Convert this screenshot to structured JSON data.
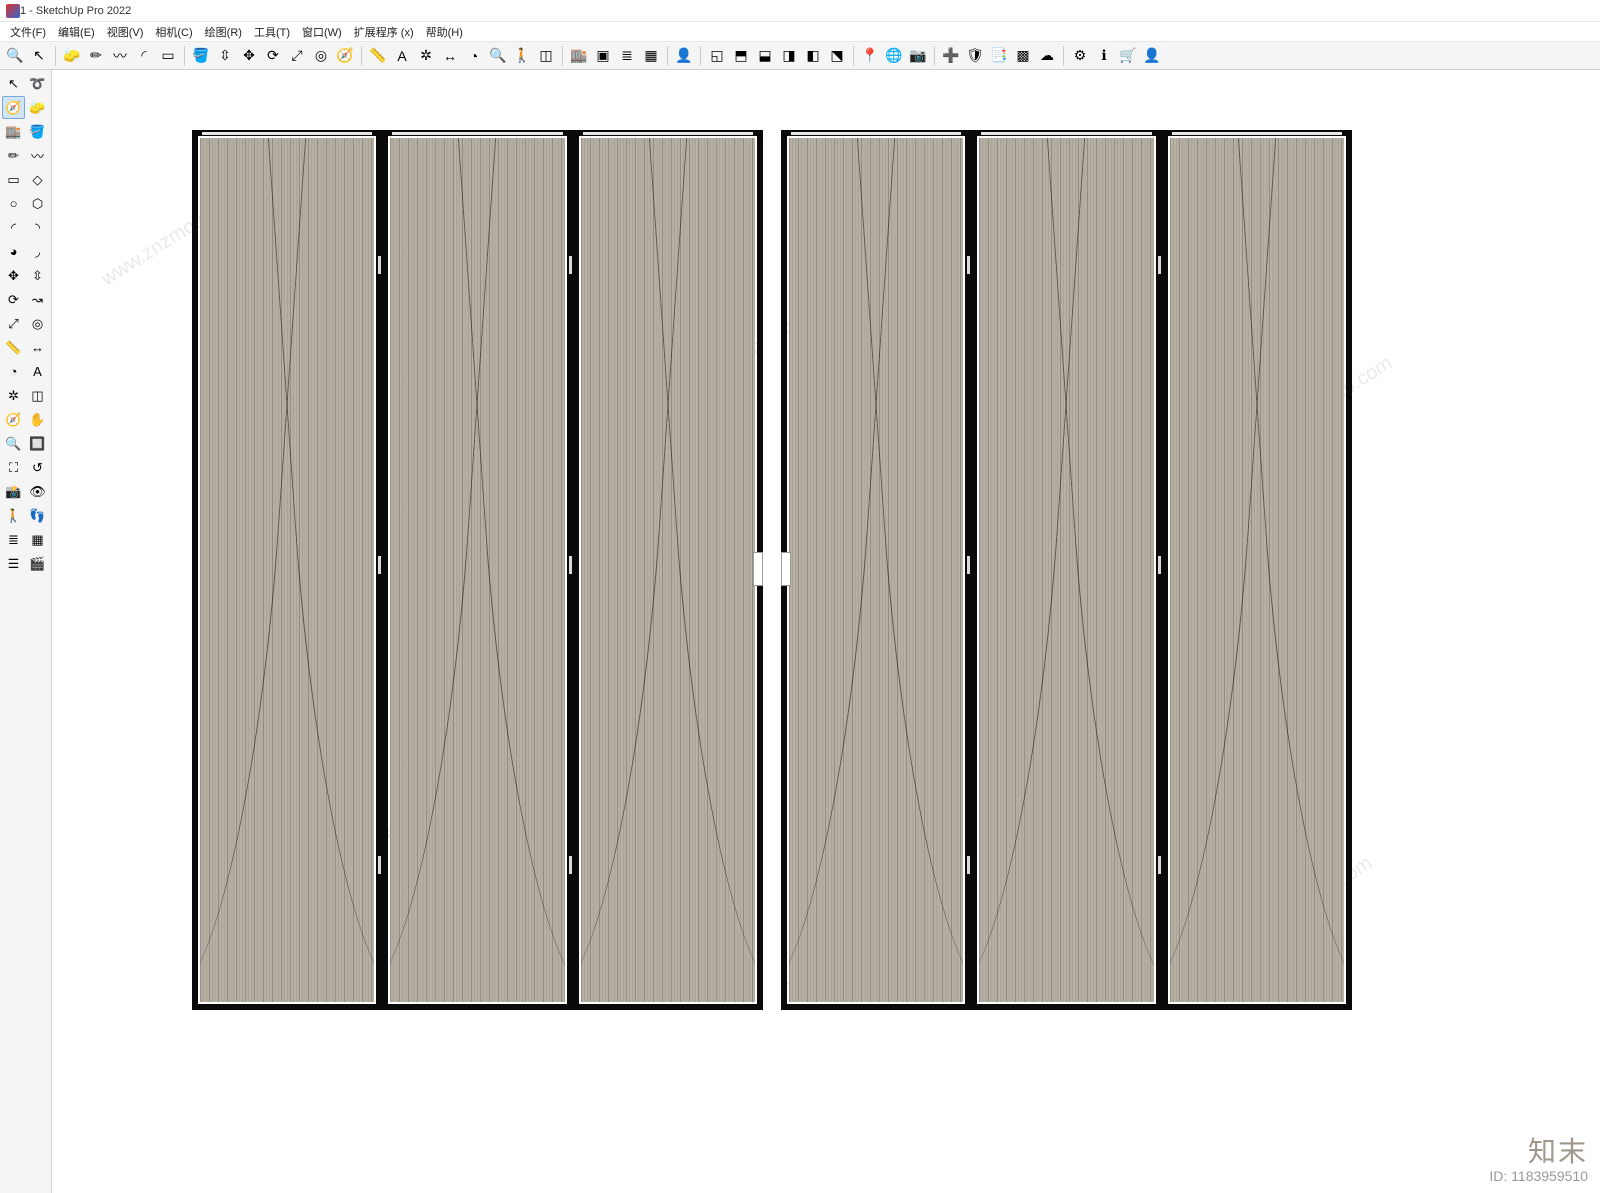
{
  "title": "1 - SketchUp Pro 2022",
  "menu": {
    "file": "文件(F)",
    "edit": "编辑(E)",
    "view": "视图(V)",
    "camera": "相机(C)",
    "draw": "绘图(R)",
    "tools": "工具(T)",
    "window": "窗口(W)",
    "extensions": "扩展程序 (x)",
    "help": "帮助(H)"
  },
  "toolbar_icons": [
    "search-icon",
    "select-icon",
    "sep",
    "eraser-icon",
    "pencil-icon",
    "freehand-icon",
    "arc-icon",
    "rectangle-icon",
    "sep",
    "paint-bucket-icon",
    "pushpull-icon",
    "move-icon",
    "rotate-icon",
    "scale-icon",
    "offset-icon",
    "orbit-icon",
    "sep",
    "tape-icon",
    "text-icon",
    "axes-icon",
    "dimension-icon",
    "protractor-icon",
    "zoom-icon",
    "walk-icon",
    "section-icon",
    "sep",
    "warehouse-icon",
    "components-icon",
    "layers-icon",
    "materials-icon",
    "sep",
    "user-icon",
    "sep",
    "iso-icon",
    "top-icon",
    "front-icon",
    "right-icon",
    "back-icon",
    "left-icon",
    "sep",
    "location-icon",
    "geo-icon",
    "camera-icon",
    "sep",
    "add-icon",
    "shield-icon",
    "report-icon",
    "checker-icon",
    "cloud-icon",
    "sep",
    "gear-icon",
    "info-icon",
    "cart-icon",
    "account-icon"
  ],
  "left_tools": [
    [
      "select-icon",
      "lasso-icon"
    ],
    [
      "orbit-icon",
      "eraser-icon"
    ],
    [
      "warehouse-icon",
      "paint-bucket-icon"
    ],
    [
      "pencil-icon",
      "freehand-icon"
    ],
    [
      "rectangle-icon",
      "rotated-rect-icon"
    ],
    [
      "circle-icon",
      "polygon-icon"
    ],
    [
      "arc-icon",
      "2pt-arc-icon"
    ],
    [
      "pie-icon",
      "3pt-arc-icon"
    ],
    [
      "move-icon",
      "pushpull-icon"
    ],
    [
      "rotate-icon",
      "followme-icon"
    ],
    [
      "scale-icon",
      "offset-icon"
    ],
    [
      "tape-icon",
      "dimension-icon"
    ],
    [
      "protractor-icon",
      "text-icon"
    ],
    [
      "axes-icon",
      "section-icon"
    ],
    [
      "orbit2-icon",
      "pan-icon"
    ],
    [
      "zoom-icon",
      "zoom-window-icon"
    ],
    [
      "zoom-extents-icon",
      "previous-icon"
    ],
    [
      "position-camera-icon",
      "look-around-icon"
    ],
    [
      "walk-icon",
      "walk2-icon"
    ],
    [
      "layers-icon",
      "materials-icon"
    ],
    [
      "outliner-icon",
      "scenes-icon"
    ]
  ],
  "glyphs": {
    "search-icon": "🔍",
    "select-icon": "↖",
    "eraser-icon": "🧽",
    "pencil-icon": "✏",
    "freehand-icon": "〰",
    "arc-icon": "◜",
    "rectangle-icon": "▭",
    "paint-bucket-icon": "🪣",
    "pushpull-icon": "⇳",
    "move-icon": "✥",
    "rotate-icon": "⟳",
    "scale-icon": "⤢",
    "offset-icon": "◎",
    "orbit-icon": "🧭",
    "tape-icon": "📏",
    "text-icon": "A",
    "axes-icon": "✲",
    "dimension-icon": "↔",
    "protractor-icon": "◔",
    "zoom-icon": "🔍",
    "walk-icon": "🚶",
    "section-icon": "◫",
    "warehouse-icon": "🏬",
    "components-icon": "▣",
    "layers-icon": "≣",
    "materials-icon": "▦",
    "user-icon": "👤",
    "iso-icon": "◱",
    "top-icon": "⬒",
    "front-icon": "⬓",
    "right-icon": "◨",
    "back-icon": "◧",
    "left-icon": "⬔",
    "location-icon": "📍",
    "geo-icon": "🌐",
    "camera-icon": "📷",
    "add-icon": "➕",
    "shield-icon": "🛡",
    "report-icon": "📑",
    "checker-icon": "▩",
    "cloud-icon": "☁",
    "gear-icon": "⚙",
    "info-icon": "ℹ",
    "cart-icon": "🛒",
    "account-icon": "👤",
    "lasso-icon": "➰",
    "circle-icon": "○",
    "polygon-icon": "⬡",
    "rotated-rect-icon": "◇",
    "2pt-arc-icon": "◝",
    "pie-icon": "◕",
    "3pt-arc-icon": "◞",
    "followme-icon": "↝",
    "zoom-window-icon": "🔲",
    "zoom-extents-icon": "⛶",
    "previous-icon": "↺",
    "position-camera-icon": "📸",
    "look-around-icon": "👁",
    "walk2-icon": "👣",
    "outliner-icon": "☰",
    "scenes-icon": "🎬",
    "orbit2-icon": "🧭",
    "pan-icon": "✋",
    "sep": ""
  },
  "watermark": {
    "brand": "知末",
    "id_label": "ID: 1183959510",
    "url": "www.znzmo.com"
  }
}
